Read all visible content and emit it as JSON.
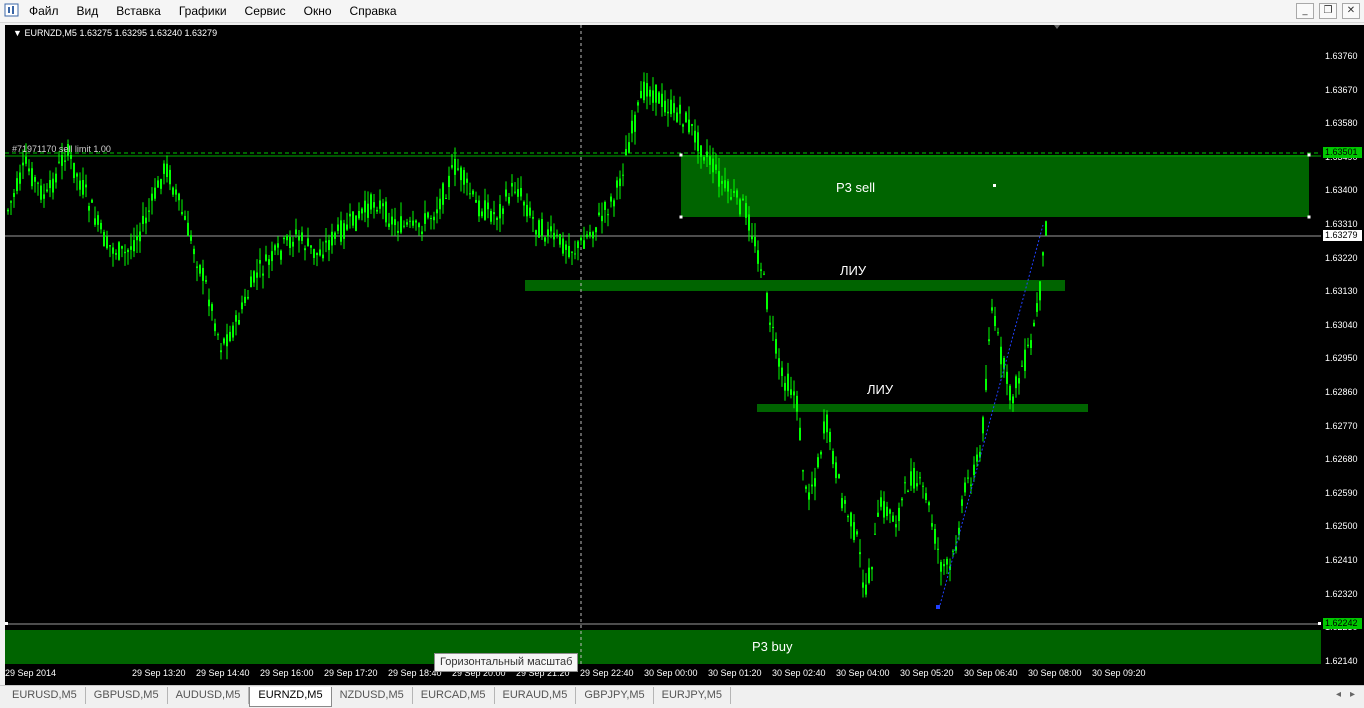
{
  "menu": {
    "items": [
      "Файл",
      "Вид",
      "Вставка",
      "Графики",
      "Сервис",
      "Окно",
      "Справка"
    ]
  },
  "window_buttons": {
    "minimize": "_",
    "restore": "❐",
    "close": "✕"
  },
  "chart": {
    "title": "EURNZD,M5  1.63275 1.63295 1.63240 1.63279",
    "order_label": "#71971170 sell limit 1.00",
    "zones": {
      "sell": "P3 sell",
      "liu_upper": "ЛИУ",
      "liu_lower": "ЛИУ",
      "buy": "P3 buy"
    },
    "tooltip": "Горизонтальный масштаб",
    "price_ticks": [
      "1.63760",
      "1.63670",
      "1.63580",
      "1.63490",
      "1.63400",
      "1.63310",
      "1.63220",
      "1.63130",
      "1.63040",
      "1.62950",
      "1.62860",
      "1.62770",
      "1.62680",
      "1.62590",
      "1.62500",
      "1.62410",
      "1.62320",
      "1.62230",
      "1.62140"
    ],
    "price_tags": {
      "sell_limit": "1.63501",
      "current": "1.63279",
      "buy_level": "1.62242"
    },
    "time_ticks": [
      "29 Sep 2014",
      "29 Sep 13:20",
      "29 Sep 14:40",
      "29 Sep 16:00",
      "29 Sep 17:20",
      "29 Sep 18:40",
      "29 Sep 20:00",
      "29 Sep 21:20",
      "29 Sep 22:40",
      "30 Sep 00:00",
      "30 Sep 01:20",
      "30 Sep 02:40",
      "30 Sep 04:00",
      "30 Sep 05:20",
      "30 Sep 06:40",
      "30 Sep 08:00",
      "30 Sep 09:20"
    ],
    "colors": {
      "background": "#000000",
      "candle": "#00ff00",
      "zone": "#006400",
      "price_tag_bg": "#00c800",
      "current_tag_bg": "#ffffff"
    },
    "price_range": [
      1.621,
      1.6383
    ]
  },
  "tabs": {
    "items": [
      "EURUSD,M5",
      "GBPUSD,M5",
      "AUDUSD,M5",
      "EURNZD,M5",
      "NZDUSD,M5",
      "EURCAD,M5",
      "EURAUD,M5",
      "GBPJPY,M5",
      "EURJPY,M5"
    ],
    "active": "EURNZD,M5"
  }
}
